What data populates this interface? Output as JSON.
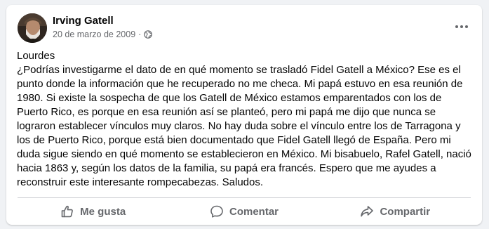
{
  "post": {
    "author": "Irving Gatell",
    "date": "20 de marzo de 2009",
    "separator": "·",
    "privacy_icon": "globe-icon",
    "menu_icon": "more-options-icon",
    "greeting": "Lourdes",
    "body": "¿Podrías investigarme el dato de en qué momento se trasladó Fidel Gatell a México? Ese es el punto donde la información que he recuperado no me checa. Mi papá estuvo en esa reunión de 1980. Si existe la sospecha de que los Gatell de México estamos emparentados con los de Puerto Rico, es porque en esa reunión así se planteó, pero mi papá me dijo que nunca se lograron establecer vínculos muy claros. No hay duda sobre el vínculo entre los de Tarragona y los de Puerto Rico, porque está bien documentado que Fidel Gatell llegó de España. Pero mi duda sigue siendo en qué momento se establecieron en México. Mi bisabuelo, Rafel Gatell, nació hacia 1863 y, según los datos de la familia, su papá era francés. Espero que me ayudes a reconstruir este interesante rompecabezas. Saludos."
  },
  "actions": {
    "like": {
      "label": "Me gusta",
      "icon": "thumbs-up-icon"
    },
    "comment": {
      "label": "Comentar",
      "icon": "comment-icon"
    },
    "share": {
      "label": "Compartir",
      "icon": "share-icon"
    }
  },
  "colors": {
    "background": "#f0f2f5",
    "card": "#ffffff",
    "text_primary": "#050505",
    "text_secondary": "#65676b"
  }
}
